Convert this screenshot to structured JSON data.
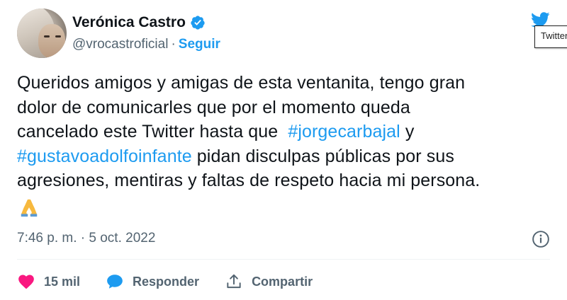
{
  "tweet": {
    "author": {
      "name": "Verónica Castro",
      "handle": "@vrocastroficial",
      "separator": "·",
      "follow_label": "Seguir",
      "avatar_icon": "avatar-photo",
      "verified_icon": "verified-badge-icon"
    },
    "twitter_logo": {
      "icon": "twitter-bird-icon",
      "tooltip": "Twitter"
    },
    "text_lines": [
      {
        "parts": [
          {
            "text": "Queridos amigos y amigas de esta ventanita, tengo gran",
            "hashtag": false
          }
        ]
      },
      {
        "parts": [
          {
            "text": "dolor de comunicarles que por el momento queda",
            "hashtag": false
          }
        ]
      },
      {
        "parts": [
          {
            "text": "cancelado este Twitter hasta que  ",
            "hashtag": false
          },
          {
            "text": "#jorgecarbajal",
            "hashtag": true
          },
          {
            "text": " y",
            "hashtag": false
          }
        ]
      },
      {
        "parts": [
          {
            "text": "#gustavoadolfoinfante",
            "hashtag": true
          },
          {
            "text": " pidan disculpas públicas por sus",
            "hashtag": false
          }
        ]
      },
      {
        "parts": [
          {
            "text": "agresiones, mentiras y faltas de respeto hacia mi persona.",
            "hashtag": false
          }
        ]
      }
    ],
    "emoji": "🙏",
    "timestamp": "7:46 p. m. · 5 oct. 2022",
    "info_icon": "info-icon",
    "actions": {
      "like_count": "15 mil",
      "reply_label": "Responder",
      "share_label": "Compartir"
    },
    "colors": {
      "accent": "#1d9bf0",
      "like": "#f91880",
      "secondary_text": "#536471",
      "primary_text": "#0f1419"
    }
  }
}
